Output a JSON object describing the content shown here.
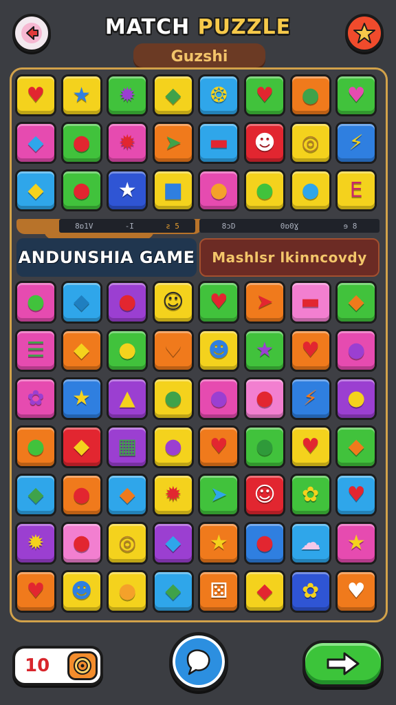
{
  "header": {
    "title_part1": "MATCH ",
    "title_part2": "PUZZLE",
    "subtitle": "Guzshi",
    "back_icon": "back-arrow-icon",
    "star_icon": "star-icon"
  },
  "board_top": [
    {
      "icon": "heart",
      "glyph": "♥",
      "bg": "#f4d21d",
      "fg": "#e22630"
    },
    {
      "icon": "star",
      "glyph": "★",
      "bg": "#f4d21d",
      "fg": "#2f7fe0"
    },
    {
      "icon": "gear",
      "glyph": "✹",
      "bg": "#41c23c",
      "fg": "#9b3fd1"
    },
    {
      "icon": "candy",
      "glyph": "◆",
      "bg": "#f4d21d",
      "fg": "#3fa24a"
    },
    {
      "icon": "spiral",
      "glyph": "❂",
      "bg": "#2fa6ea",
      "fg": "#f4d21d"
    },
    {
      "icon": "heart",
      "glyph": "♥",
      "bg": "#41c23c",
      "fg": "#e22630"
    },
    {
      "icon": "bean",
      "glyph": "●",
      "bg": "#f07a1c",
      "fg": "#3fa24a"
    },
    {
      "icon": "heart",
      "glyph": "♥",
      "bg": "#41c23c",
      "fg": "#e64bb0"
    },
    {
      "icon": "cube",
      "glyph": "◆",
      "bg": "#e64bb0",
      "fg": "#2fa6ea"
    },
    {
      "icon": "apple",
      "glyph": "●",
      "bg": "#41c23c",
      "fg": "#e22630"
    },
    {
      "icon": "gear",
      "glyph": "✹",
      "bg": "#e64bb0",
      "fg": "#e22630"
    },
    {
      "icon": "arrow",
      "glyph": "➤",
      "bg": "#f07a1c",
      "fg": "#3fa24a"
    },
    {
      "icon": "block",
      "glyph": "▬",
      "bg": "#2fa6ea",
      "fg": "#e22630"
    },
    {
      "icon": "skull",
      "glyph": "☻",
      "bg": "#e22630",
      "fg": "#ffffff"
    },
    {
      "icon": "swirl",
      "glyph": "◎",
      "bg": "#f4d21d",
      "fg": "#b07a2a"
    },
    {
      "icon": "bolt",
      "glyph": "⚡",
      "bg": "#2f7fe0",
      "fg": "#f4d21d"
    },
    {
      "icon": "bird",
      "glyph": "◆",
      "bg": "#2fa6ea",
      "fg": "#f4d21d"
    },
    {
      "icon": "apple",
      "glyph": "●",
      "bg": "#41c23c",
      "fg": "#e22630"
    },
    {
      "icon": "star",
      "glyph": "★",
      "bg": "#2f55d4",
      "fg": "#ffffff"
    },
    {
      "icon": "car",
      "glyph": "■",
      "bg": "#f4d21d",
      "fg": "#2f7fe0"
    },
    {
      "icon": "peach",
      "glyph": "●",
      "bg": "#e64bb0",
      "fg": "#f4a12a"
    },
    {
      "icon": "apple",
      "glyph": "●",
      "bg": "#f4d21d",
      "fg": "#41c23c"
    },
    {
      "icon": "bubble",
      "glyph": "●",
      "bg": "#f4d21d",
      "fg": "#2fa6ea"
    },
    {
      "icon": "letter",
      "glyph": "E",
      "bg": "#f4d21d",
      "fg": "#c6286a"
    }
  ],
  "strip": {
    "a1": "8ɒ1V",
    "a2": "-I",
    "a3": "ƨ 5",
    "b1": "8ɔD",
    "b2": "0ɒ0Ɣ",
    "b3": "ɘ 8"
  },
  "banners": {
    "left": "ANDUNSHIA GAME",
    "right": "Mashlsr lkinncovdy"
  },
  "board_bottom": [
    {
      "icon": "leaf",
      "glyph": "●",
      "bg": "#e64bb0",
      "fg": "#41c23c"
    },
    {
      "icon": "cube",
      "glyph": "◆",
      "bg": "#2fa6ea",
      "fg": "#1f7fc0"
    },
    {
      "icon": "apple",
      "glyph": "●",
      "bg": "#9b3fd1",
      "fg": "#e22630"
    },
    {
      "icon": "face",
      "glyph": "☺",
      "bg": "#f4d21d",
      "fg": "#2b2b2b"
    },
    {
      "icon": "heart",
      "glyph": "♥",
      "bg": "#41c23c",
      "fg": "#e22630"
    },
    {
      "icon": "rocket",
      "glyph": "➤",
      "bg": "#f07a1c",
      "fg": "#e22630"
    },
    {
      "icon": "card",
      "glyph": "▬",
      "bg": "#f27fd0",
      "fg": "#e22630"
    },
    {
      "icon": "carrot",
      "glyph": "◆",
      "bg": "#41c23c",
      "fg": "#f07a1c"
    },
    {
      "icon": "list",
      "glyph": "☰",
      "bg": "#e64bb0",
      "fg": "#3fa24a"
    },
    {
      "icon": "bird",
      "glyph": "◆",
      "bg": "#f07a1c",
      "fg": "#f4d21d"
    },
    {
      "icon": "lemon",
      "glyph": "●",
      "bg": "#41c23c",
      "fg": "#f4d21d"
    },
    {
      "icon": "heart",
      "glyph": "♥",
      "bg": "#f07a1c",
      "fg": "#f07a1c"
    },
    {
      "icon": "frog",
      "glyph": "☻",
      "bg": "#f4d21d",
      "fg": "#2f7fe0"
    },
    {
      "icon": "star",
      "glyph": "★",
      "bg": "#41c23c",
      "fg": "#9b3fd1"
    },
    {
      "icon": "heart",
      "glyph": "♥",
      "bg": "#f07a1c",
      "fg": "#e22630"
    },
    {
      "icon": "plum",
      "glyph": "●",
      "bg": "#e64bb0",
      "fg": "#9b3fd1"
    },
    {
      "icon": "grapes",
      "glyph": "✿",
      "bg": "#e64bb0",
      "fg": "#9b3fd1"
    },
    {
      "icon": "star",
      "glyph": "★",
      "bg": "#2f7fe0",
      "fg": "#f4d21d"
    },
    {
      "icon": "pear",
      "glyph": "▲",
      "bg": "#9b3fd1",
      "fg": "#f4d21d"
    },
    {
      "icon": "bean",
      "glyph": "●",
      "bg": "#f4d21d",
      "fg": "#3fa24a"
    },
    {
      "icon": "plum",
      "glyph": "●",
      "bg": "#e64bb0",
      "fg": "#9b3fd1"
    },
    {
      "icon": "berry",
      "glyph": "●",
      "bg": "#f27fd0",
      "fg": "#e22630"
    },
    {
      "icon": "bolt",
      "glyph": "⚡",
      "bg": "#2f7fe0",
      "fg": "#f07a1c"
    },
    {
      "icon": "lemon",
      "glyph": "●",
      "bg": "#9b3fd1",
      "fg": "#f4d21d"
    },
    {
      "icon": "apple",
      "glyph": "●",
      "bg": "#f07a1c",
      "fg": "#41c23c"
    },
    {
      "icon": "carrot",
      "glyph": "◆",
      "bg": "#e22630",
      "fg": "#f4d21d"
    },
    {
      "icon": "grid",
      "glyph": "▦",
      "bg": "#9b3fd1",
      "fg": "#3fa24a"
    },
    {
      "icon": "grape",
      "glyph": "●",
      "bg": "#f4d21d",
      "fg": "#9b3fd1"
    },
    {
      "icon": "heart",
      "glyph": "♥",
      "bg": "#f07a1c",
      "fg": "#e22630"
    },
    {
      "icon": "leaf",
      "glyph": "●",
      "bg": "#41c23c",
      "fg": "#2f9a3a"
    },
    {
      "icon": "heart",
      "glyph": "♥",
      "bg": "#f4d21d",
      "fg": "#e22630"
    },
    {
      "icon": "carrot",
      "glyph": "◆",
      "bg": "#41c23c",
      "fg": "#f07a1c"
    },
    {
      "icon": "candy",
      "glyph": "◆",
      "bg": "#2fa6ea",
      "fg": "#3fa24a"
    },
    {
      "icon": "apple",
      "glyph": "●",
      "bg": "#f07a1c",
      "fg": "#e22630"
    },
    {
      "icon": "carrot",
      "glyph": "◆",
      "bg": "#2fa6ea",
      "fg": "#f07a1c"
    },
    {
      "icon": "gear",
      "glyph": "✹",
      "bg": "#f4d21d",
      "fg": "#e22630"
    },
    {
      "icon": "plane",
      "glyph": "➤",
      "bg": "#41c23c",
      "fg": "#2fa6ea"
    },
    {
      "icon": "face",
      "glyph": "☺",
      "bg": "#e22630",
      "fg": "#ffffff"
    },
    {
      "icon": "bug",
      "glyph": "✿",
      "bg": "#41c23c",
      "fg": "#f4d21d"
    },
    {
      "icon": "heart",
      "glyph": "♥",
      "bg": "#2fa6ea",
      "fg": "#e22630"
    },
    {
      "icon": "sun",
      "glyph": "✹",
      "bg": "#9b3fd1",
      "fg": "#f4d21d"
    },
    {
      "icon": "apple",
      "glyph": "●",
      "bg": "#f27fd0",
      "fg": "#e22630"
    },
    {
      "icon": "swirl",
      "glyph": "◎",
      "bg": "#f4d21d",
      "fg": "#b07a2a"
    },
    {
      "icon": "leaf",
      "glyph": "◆",
      "bg": "#9b3fd1",
      "fg": "#2fa6ea"
    },
    {
      "icon": "star",
      "glyph": "★",
      "bg": "#f07a1c",
      "fg": "#f4d21d"
    },
    {
      "icon": "berry",
      "glyph": "●",
      "bg": "#2f7fe0",
      "fg": "#e22630"
    },
    {
      "icon": "cloud",
      "glyph": "☁",
      "bg": "#2fa6ea",
      "fg": "#f4c8e8"
    },
    {
      "icon": "star",
      "glyph": "★",
      "bg": "#e64bb0",
      "fg": "#f4d21d"
    },
    {
      "icon": "heart",
      "glyph": "♥",
      "bg": "#f07a1c",
      "fg": "#e22630"
    },
    {
      "icon": "robot",
      "glyph": "☻",
      "bg": "#f4d21d",
      "fg": "#2f7fe0"
    },
    {
      "icon": "lemon",
      "glyph": "●",
      "bg": "#f4d21d",
      "fg": "#f4a12a"
    },
    {
      "icon": "leaf",
      "glyph": "◆",
      "bg": "#2fa6ea",
      "fg": "#3fa24a"
    },
    {
      "icon": "dice",
      "glyph": "⚄",
      "bg": "#f07a1c",
      "fg": "#ffffff"
    },
    {
      "icon": "kite",
      "glyph": "◆",
      "bg": "#f4d21d",
      "fg": "#e22630"
    },
    {
      "icon": "flower",
      "glyph": "✿",
      "bg": "#2f55d4",
      "fg": "#f4d21d"
    },
    {
      "icon": "heart",
      "glyph": "♥",
      "bg": "#f07a1c",
      "fg": "#ffffff"
    }
  ],
  "footer": {
    "moves": "10",
    "moves_icon": "target-icon",
    "hint_icon": "hint-bubble-icon",
    "next_icon": "arrow-right-icon"
  }
}
